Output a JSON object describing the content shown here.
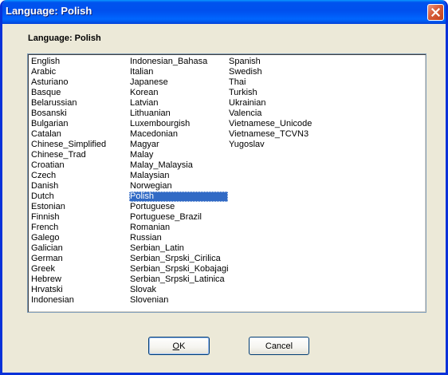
{
  "window": {
    "title": "Language: Polish"
  },
  "heading": "Language: Polish",
  "languages": {
    "columns": [
      [
        "English",
        "Arabic",
        "Asturiano",
        "Basque",
        "Belarussian",
        "Bosanski",
        "Bulgarian",
        "Catalan",
        "Chinese_Simplified",
        "Chinese_Trad",
        "Croatian",
        "Czech",
        "Danish",
        "Dutch",
        "Estonian",
        "Finnish",
        "French",
        "Galego",
        "Galician",
        "German",
        "Greek",
        "Hebrew",
        "Hrvatski",
        "Indonesian"
      ],
      [
        "Indonesian_Bahasa",
        "Italian",
        "Japanese",
        "Korean",
        "Latvian",
        "Lithuanian",
        "Luxembourgish",
        "Macedonian",
        "Magyar",
        "Malay",
        "Malay_Malaysia",
        "Malaysian",
        "Norwegian",
        "Polish",
        "Portuguese",
        "Portuguese_Brazil",
        "Romanian",
        "Russian",
        "Serbian_Latin",
        "Serbian_Srpski_Cirilica",
        "Serbian_Srpski_Kobajagi",
        "Serbian_Srpski_Latinica",
        "Slovak",
        "Slovenian"
      ],
      [
        "Spanish",
        "Swedish",
        "Thai",
        "Turkish",
        "Ukrainian",
        "Valencia",
        "Vietnamese_Unicode",
        "Vietnamese_TCVN3",
        "Yugoslav"
      ]
    ],
    "selected": "Polish"
  },
  "buttons": {
    "ok": {
      "label": "OK",
      "mnemonic": "O",
      "rest": "K"
    },
    "cancel": {
      "label": "Cancel"
    }
  },
  "colors": {
    "selection": "#316ac5",
    "titlebar": "#0053ee",
    "dialog": "#ece9d8"
  }
}
